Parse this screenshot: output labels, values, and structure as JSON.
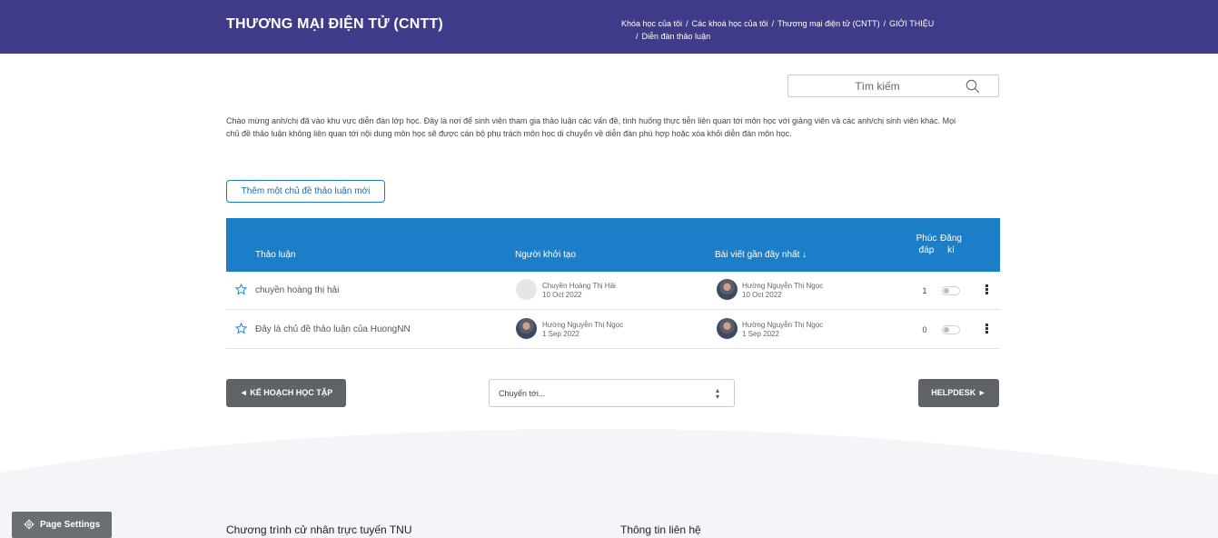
{
  "header": {
    "course_title": "THƯƠNG MẠI ĐIỆN TỬ (CNTT)",
    "breadcrumb": [
      "Khóa học của tôi",
      "Các khoá học của tôi",
      "Thương mại điện tử (CNTT)",
      "GIỚI THIỆU",
      "Diễn đàn thảo luận"
    ],
    "separator": "/"
  },
  "search": {
    "placeholder": "Tìm kiếm"
  },
  "intro": "Chào mừng anh/chị đã vào khu vực diễn đàn lớp học. Đây là nơi để sinh viên tham gia thảo luận các vấn đề, tình huống thực tiễn liên quan tới môn học với giảng viên và các anh/chị sinh viên khác. Mọi chủ đề thảo luận không liên quan tới nội dung môn học sẽ được cán bộ phụ trách môn học di chuyển về diễn đàn phù hợp hoặc xóa khỏi diễn đàn môn học.",
  "add_topic_label": "Thêm một chủ đề thảo luận mới",
  "table": {
    "headers": {
      "topic": "Thảo luận",
      "starter": "Người khởi tạo",
      "last_post": "Bài viết gần đây nhất ↓",
      "replies": "Phúc đáp",
      "subscribe": "Đăng kí"
    },
    "rows": [
      {
        "topic": "chuyền hoàng thị hải",
        "starter_name": "Chuyền Hoàng Thị Hải",
        "starter_date": "10 Oct 2022",
        "last_name": "Hường Nguyễn Thị Ngọc",
        "last_date": "10 Oct 2022",
        "replies": "1"
      },
      {
        "topic": "Đây là chủ đề thảo luận của HuongNN",
        "starter_name": "Hường Nguyễn Thị Ngọc",
        "starter_date": "1 Sep 2022",
        "last_name": "Hường Nguyễn Thị Ngọc",
        "last_date": "1 Sep 2022",
        "replies": "0"
      }
    ]
  },
  "nav": {
    "prev_label": "◄ KẾ HOẠCH HỌC TẬP",
    "jump_label": "Chuyển tới...",
    "next_label": "HELPDESK ►"
  },
  "footer": {
    "page_settings": "Page Settings",
    "col1_title": "Chương trình cử nhân trực tuyến TNU",
    "col2_title": "Thông tin liên hệ"
  },
  "colors": {
    "header_bg": "#3f3b88",
    "table_head_bg": "#1c7ec8",
    "button_gray": "#5f6368"
  },
  "icons": [
    "search-icon",
    "star-icon",
    "kebab-icon",
    "gear-icon",
    "chevron-updown-icon"
  ]
}
